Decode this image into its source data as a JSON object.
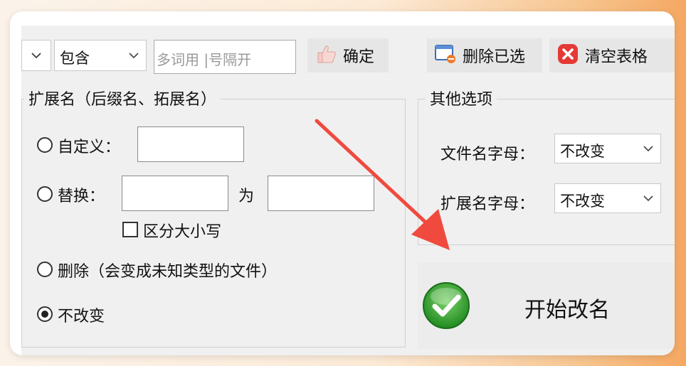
{
  "toolbar": {
    "match_mode": "包含",
    "keyword_placeholder": "多词用 |号隔开",
    "confirm_label": "确定",
    "delete_selected_label": "删除已选",
    "clear_table_label": "清空表格"
  },
  "extension_group": {
    "title": "扩展名（后缀名、拓展名）",
    "custom_label": "自定义：",
    "replace_label": "替换：",
    "replace_to_label": "为",
    "case_sensitive_label": "区分大小写",
    "delete_label": "删除（会变成未知类型的文件）",
    "unchanged_label": "不改变",
    "selected_option": "unchanged"
  },
  "other_group": {
    "title": "其他选项",
    "filename_case_label": "文件名字母：",
    "filename_case_value": "不改变",
    "ext_case_label": "扩展名字母：",
    "ext_case_value": "不改变"
  },
  "start_label": "开始改名",
  "colors": {
    "annotation_arrow": "#f04a3e",
    "start_icon_green": "#2e9e2e",
    "clear_icon_red": "#e53935"
  }
}
